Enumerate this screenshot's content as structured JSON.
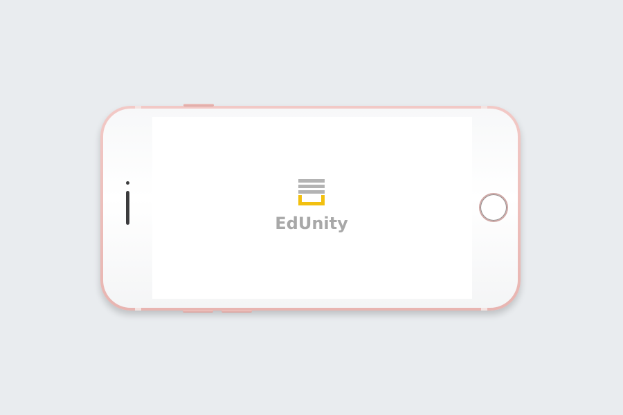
{
  "device": {
    "type": "phone-mockup-landscape",
    "finish_color": "#eab9b5"
  },
  "app": {
    "brand_name": "EdUnity",
    "logo_icon": "edunity-logo-icon",
    "colors": {
      "logo_gray": "#b1b1b1",
      "logo_accent": "#f2c010",
      "text": "#a8a8a8",
      "screen_bg": "#ffffff",
      "page_bg": "#e9ecef"
    }
  }
}
